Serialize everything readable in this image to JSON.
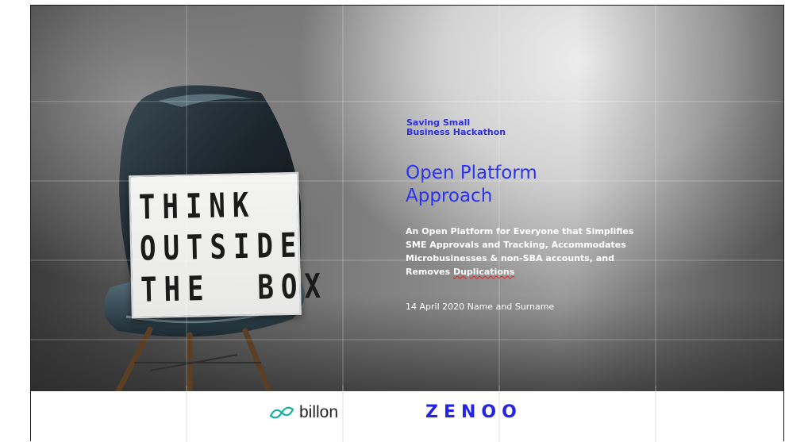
{
  "slide": {
    "sign_lines": [
      "THINK",
      "OUTSIDE",
      "THE  BOX"
    ],
    "hackathon_title_line1": "Saving Small",
    "hackathon_title_line2": "Business Hackathon",
    "title_line1": "Open Platform",
    "title_line2": "Approach",
    "subtitle_line1": "An Open Platform for Everyone that Simplifies",
    "subtitle_line2": "SME Approvals and Tracking, Accommodates",
    "subtitle_line3": "Microbusinesses & non-SBA accounts, and",
    "subtitle_line4_prefix": "Removes ",
    "subtitle_line4_underlined": "Duplications",
    "date_author": "14 April 2020 Name and Surname"
  },
  "footer": {
    "billon_logo": "billon",
    "zenoo_logo": "ZENOO"
  },
  "colors": {
    "accent_blue": "#2b33f2",
    "zenoo_blue": "#2424e6",
    "subtitle_text": "#ffffff"
  },
  "icons": [
    "billon-infinity-icon"
  ]
}
